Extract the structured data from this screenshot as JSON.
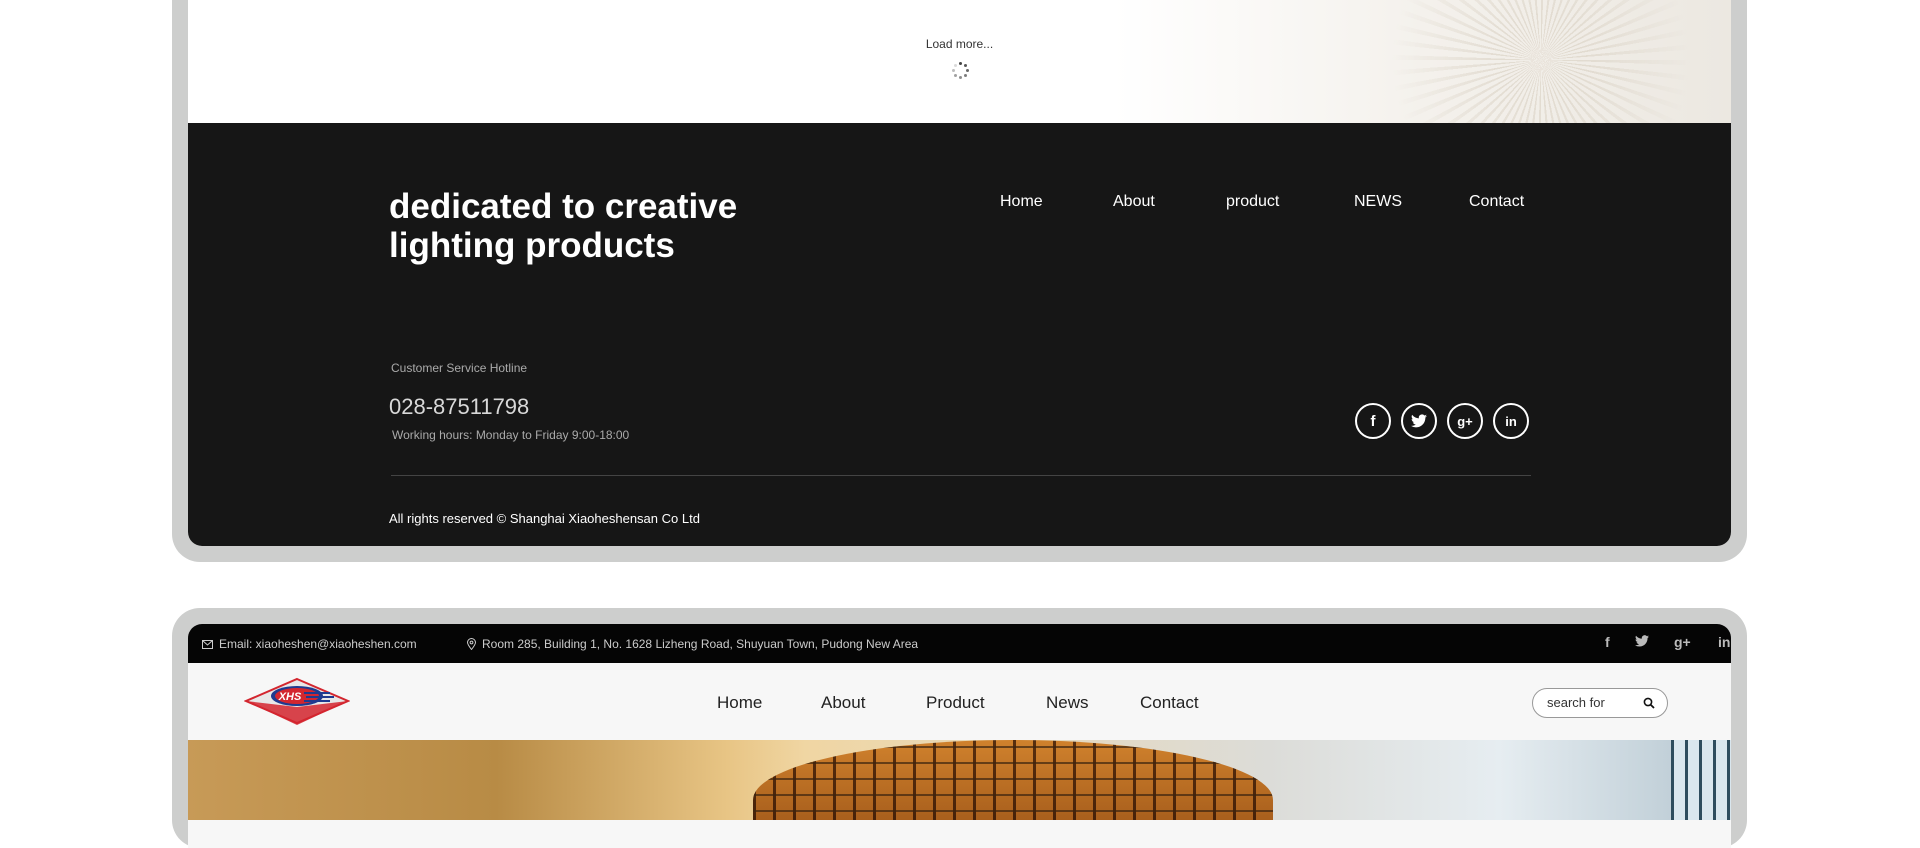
{
  "load_more": {
    "label": "Load more..."
  },
  "footer": {
    "tagline": "dedicated to creative lighting products",
    "nav": [
      "Home",
      "About",
      "product",
      "NEWS",
      "Contact"
    ],
    "hotline_label": "Customer Service Hotline",
    "phone": "028-87511798",
    "hours": "Working hours: Monday to Friday 9:00-18:00",
    "social": [
      {
        "icon": "facebook-icon",
        "glyph": "f"
      },
      {
        "icon": "twitter-icon",
        "glyph": "🐦"
      },
      {
        "icon": "google-plus-icon",
        "glyph": "g+"
      },
      {
        "icon": "linkedin-icon",
        "glyph": "in"
      }
    ],
    "copyright": "All rights reserved © Shanghai Xiaoheshensan Co Ltd"
  },
  "header": {
    "email": "Email: xiaoheshen@xiaoheshen.com",
    "address": "Room 285, Building 1, No. 1628 Lizheng Road, Shuyuan Town, Pudong New Area",
    "social": [
      "f",
      "🐦",
      "g+",
      "in"
    ],
    "logo_text": "XHS",
    "nav": [
      "Home",
      "About",
      "Product",
      "News",
      "Contact"
    ],
    "search_placeholder": "search for"
  },
  "colors": {
    "footer_bg": "#161616",
    "frame": "#cdcecd",
    "logo_red": "#d3262f",
    "logo_blue": "#1f3a8f"
  }
}
